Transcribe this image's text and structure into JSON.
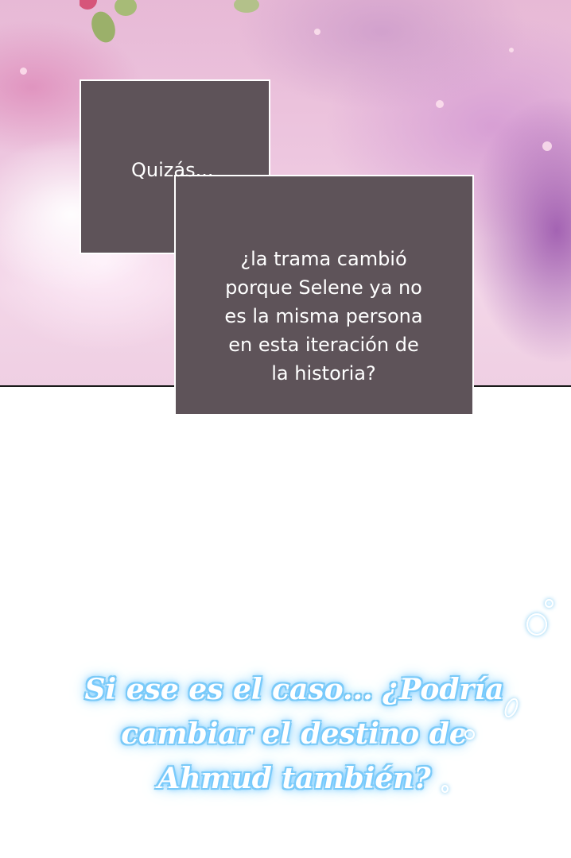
{
  "box1": {
    "text": "Quizás..."
  },
  "box2": {
    "lines": [
      "¿la trama cambió",
      "porque Selene ya no",
      "es la misma persona",
      "en esta iteración de",
      "la historia?"
    ]
  },
  "thought": {
    "lines": [
      "Si ese es el caso... ¿Podría",
      "cambiar el destino de",
      "Ahmud también?"
    ]
  },
  "colors": {
    "box_fill": "#5e5359",
    "glow": "#7cc8f0"
  }
}
